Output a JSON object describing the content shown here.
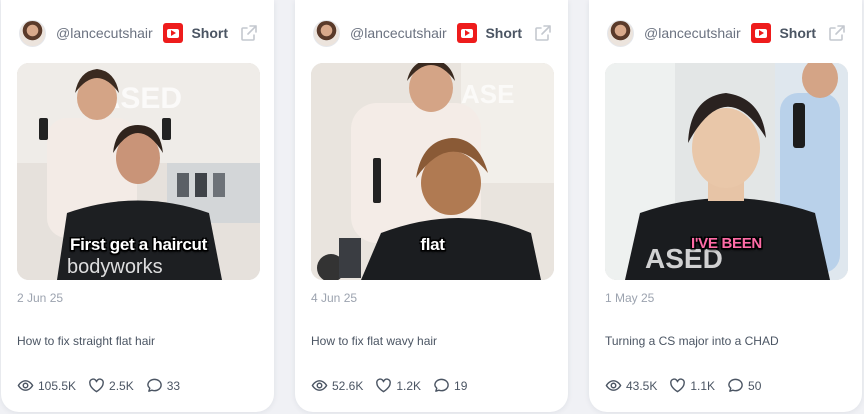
{
  "colors": {
    "youtube_red": "#ee1c1c",
    "card_bg": "#ffffff",
    "page_bg": "#f0f1f5",
    "muted": "#9ca3af"
  },
  "cards": [
    {
      "handle": "@lancecutshair",
      "platform_icon": "youtube-icon",
      "type": "Short",
      "caption": "First get a haircut",
      "date": "2 Jun 25",
      "title": "How to fix straight flat hair",
      "views": "105.5K",
      "likes": "2.5K",
      "comments": "33"
    },
    {
      "handle": "@lancecutshair",
      "platform_icon": "youtube-icon",
      "type": "Short",
      "caption": "flat",
      "date": "4 Jun 25",
      "title": "How to fix flat wavy hair",
      "views": "52.6K",
      "likes": "1.2K",
      "comments": "19"
    },
    {
      "handle": "@lancecutshair",
      "platform_icon": "youtube-icon",
      "type": "Short",
      "caption": "I'VE BEEN",
      "date": "1 May 25",
      "title": "Turning a CS major into a CHAD",
      "views": "43.5K",
      "likes": "1.1K",
      "comments": "50"
    }
  ]
}
